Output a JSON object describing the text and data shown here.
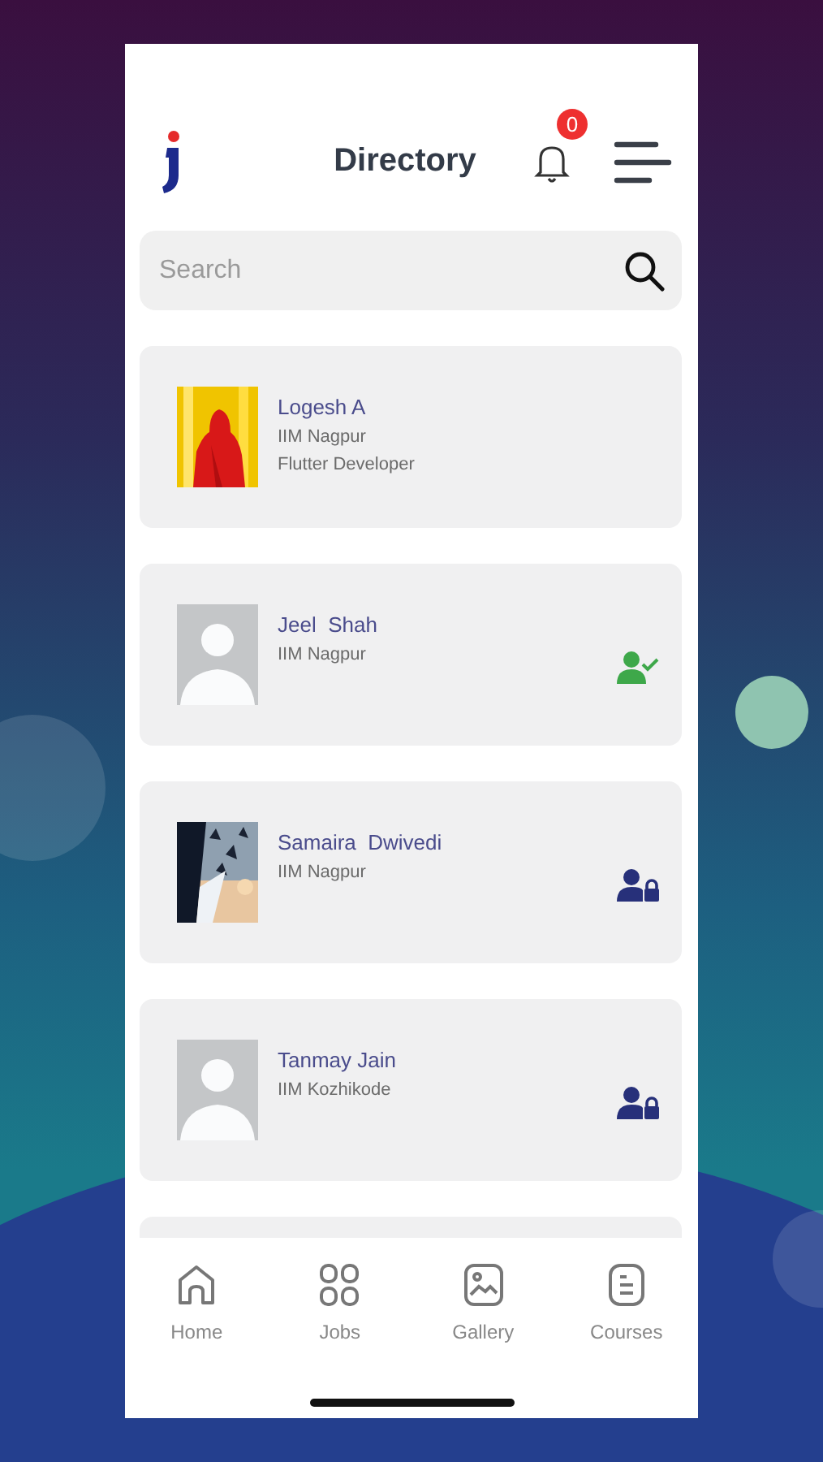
{
  "header": {
    "title": "Directory",
    "notification_count": "0"
  },
  "search": {
    "placeholder": "Search"
  },
  "members": [
    {
      "name": "Logesh A",
      "institute": "IIM Nagpur",
      "role": "Flutter Developer"
    },
    {
      "name": "Jeel  Shah",
      "institute": "IIM Nagpur",
      "avatar": {
        "kind": "placeholder"
      },
      "status_icon": {
        "kind": "verified"
      }
    },
    {
      "name": "Samaira  Dwivedi",
      "institute": "IIM Nagpur",
      "status_icon": {
        "kind": "locked"
      }
    },
    {
      "name": "Tanmay Jain",
      "institute": "IIM Kozhikode",
      "avatar": {
        "kind": "placeholder"
      },
      "status_icon": {
        "kind": "locked"
      }
    }
  ],
  "bottom_nav": [
    {
      "label": "Home"
    },
    {
      "label": "Jobs"
    },
    {
      "label": "Gallery"
    },
    {
      "label": "Courses"
    }
  ]
}
